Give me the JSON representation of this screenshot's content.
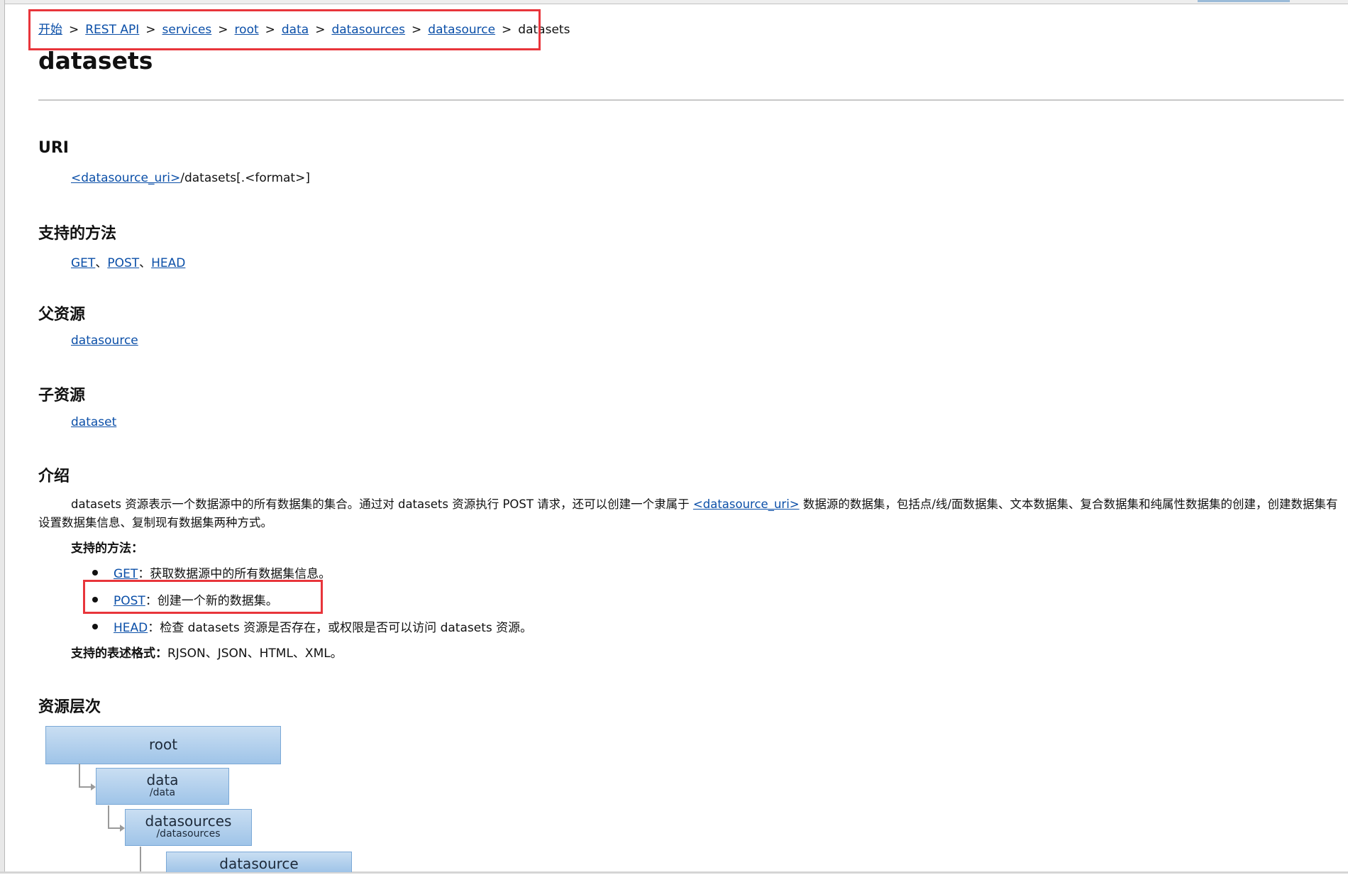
{
  "breadcrumb": [
    {
      "label": "开始",
      "link": true
    },
    {
      "label": "REST API",
      "link": true
    },
    {
      "label": "services",
      "link": true
    },
    {
      "label": "root",
      "link": true
    },
    {
      "label": "data",
      "link": true
    },
    {
      "label": "datasources",
      "link": true
    },
    {
      "label": "datasource",
      "link": true
    },
    {
      "label": "datasets",
      "link": false
    }
  ],
  "breadcrumb_separator": ">",
  "title": "datasets",
  "sections": {
    "uri": {
      "heading": "URI",
      "link": "<datasource_uri>",
      "suffix": "/datasets[.<format>]"
    },
    "methods": {
      "heading": "支持的方法",
      "items": [
        "GET",
        "POST",
        "HEAD"
      ],
      "separator": "、"
    },
    "parent": {
      "heading": "父资源",
      "item": "datasource"
    },
    "child": {
      "heading": "子资源",
      "item": "dataset"
    },
    "intro": {
      "heading": "介绍",
      "text_before": "datasets 资源表示一个数据源中的所有数据集的集合。通过对 datasets 资源执行 POST 请求，还可以创建一个隶属于 ",
      "link": "<datasource_uri>",
      "text_after": " 数据源的数据集，包括点/线/面数据集、文本数据集、复合数据集和纯属性数据集的创建，创建数据集有设置数据集信息、复制现有数据集两种方式。",
      "methods_label": "支持的方法：",
      "method_items": [
        {
          "method": "GET",
          "desc": "：获取数据源中的所有数据集信息。"
        },
        {
          "method": "POST",
          "desc": "：创建一个新的数据集。"
        },
        {
          "method": "HEAD",
          "desc": "：检查 datasets 资源是否存在，或权限是否可以访问 datasets 资源。"
        }
      ],
      "formats_label": "支持的表述格式：",
      "formats_value": "RJSON、JSON、HTML、XML。"
    },
    "hierarchy": {
      "heading": "资源层次",
      "nodes": [
        {
          "name": "root",
          "path": ""
        },
        {
          "name": "data",
          "path": "/data"
        },
        {
          "name": "datasources",
          "path": "/datasources"
        },
        {
          "name": "datasource",
          "path": ""
        }
      ]
    }
  },
  "colors": {
    "link": "#0b4fa8",
    "highlight": "#e8353b",
    "node_fill": "#b4d2ee"
  }
}
